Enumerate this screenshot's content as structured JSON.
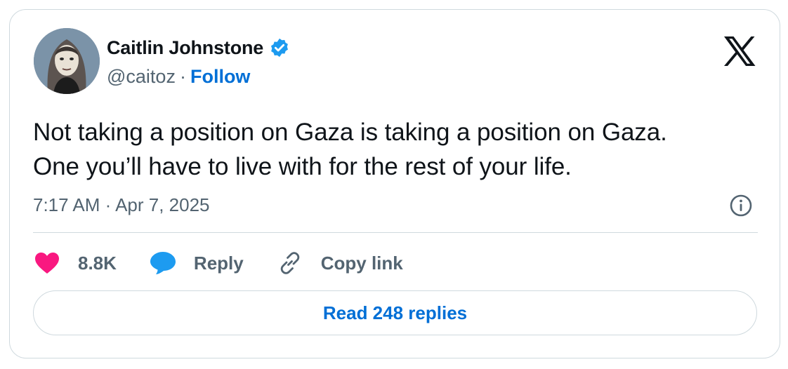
{
  "author": {
    "name": "Caitlin Johnstone",
    "handle": "@caitoz",
    "separator": "·",
    "follow_label": "Follow",
    "verified_icon": "verified-badge-icon"
  },
  "brand_icon": "x-logo-icon",
  "tweet": {
    "lines": [
      "Not taking a position on Gaza is taking a position on Gaza.",
      "One you’ll have to live with for the rest of your life."
    ],
    "timestamp": "7:17 AM · Apr 7, 2025"
  },
  "actions": {
    "like": {
      "icon": "heart-icon",
      "label": "8.8K"
    },
    "reply": {
      "icon": "speech-bubble-icon",
      "label": "Reply"
    },
    "copy": {
      "icon": "link-icon",
      "label": "Copy link"
    }
  },
  "read_replies_label": "Read 248 replies",
  "colors": {
    "accent": "#006fd6",
    "verified": "#1d9bf0",
    "like": "#f91880",
    "muted": "#536471",
    "border": "#cfd9de"
  }
}
